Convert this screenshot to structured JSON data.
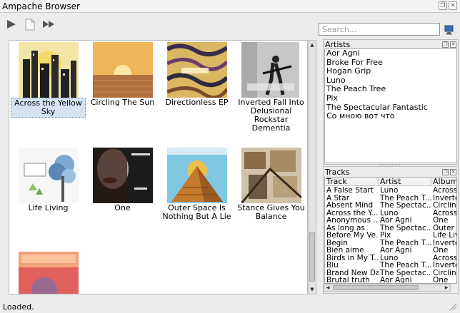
{
  "window": {
    "title": "Ampache Browser",
    "controls": [
      "restore-icon",
      "close-icon"
    ]
  },
  "toolbar": {
    "buttons": [
      "play-icon",
      "add-icon",
      "next-icon"
    ],
    "search_placeholder": "Search...",
    "action_icon": "network-icon"
  },
  "albums": [
    {
      "title": "Across the Yellow Sky",
      "art": "city-skyline-art",
      "selected": true
    },
    {
      "title": "Circling The Sun",
      "art": "sunset-art",
      "selected": false
    },
    {
      "title": "Directionless EP",
      "art": "swirl-art",
      "selected": false
    },
    {
      "title": "Inverted Fall Into Delusional Rockstar Dementia",
      "art": "guitarist-art",
      "selected": false
    },
    {
      "title": "Life Living",
      "art": "tree-art",
      "selected": false
    },
    {
      "title": "One",
      "art": "portrait-art",
      "selected": false
    },
    {
      "title": "Outer Space Is Nothing But A Lie",
      "art": "pyramid-art",
      "selected": false
    },
    {
      "title": "Stance Gives You Balance",
      "art": "collage-art",
      "selected": false
    },
    {
      "title": "",
      "art": "partial-album-art",
      "selected": false
    }
  ],
  "artists_panel": {
    "title": "Artists",
    "items": [
      "Aor Agni",
      "Broke For Free",
      "Hogan Grip",
      "Luno",
      "The Peach Tree",
      "Pix",
      "The Spectacular Fantastic",
      "Со мною вот что"
    ]
  },
  "tracks_panel": {
    "title": "Tracks",
    "columns": [
      "Track",
      "Artist",
      "Album"
    ],
    "rows": [
      [
        "A False Start",
        "Luno",
        "Across"
      ],
      [
        "A Star",
        "The Peach T...",
        "Inverte"
      ],
      [
        "Absent Mind",
        "The Spectac...",
        "Circlin"
      ],
      [
        "Across the Y...",
        "Luno",
        "Across"
      ],
      [
        "Anonymous ...",
        "Aor Agni",
        "One"
      ],
      [
        "As long as",
        "The Spectac...",
        "Outer"
      ],
      [
        "Before My Ve...",
        "Pix",
        "Life Liv"
      ],
      [
        "Begin",
        "The Peach T...",
        "Inverte"
      ],
      [
        "Bien aime",
        "Aor Agni",
        "One"
      ],
      [
        "Birds in My T...",
        "Luno",
        "Across"
      ],
      [
        "Blu",
        "The Peach T...",
        "Inverte"
      ],
      [
        "Brand New Day",
        "The Spectac...",
        "Circlin"
      ],
      [
        "Brutal truth",
        "Aor Agni",
        "One"
      ]
    ]
  },
  "status": {
    "text": "Loaded."
  }
}
